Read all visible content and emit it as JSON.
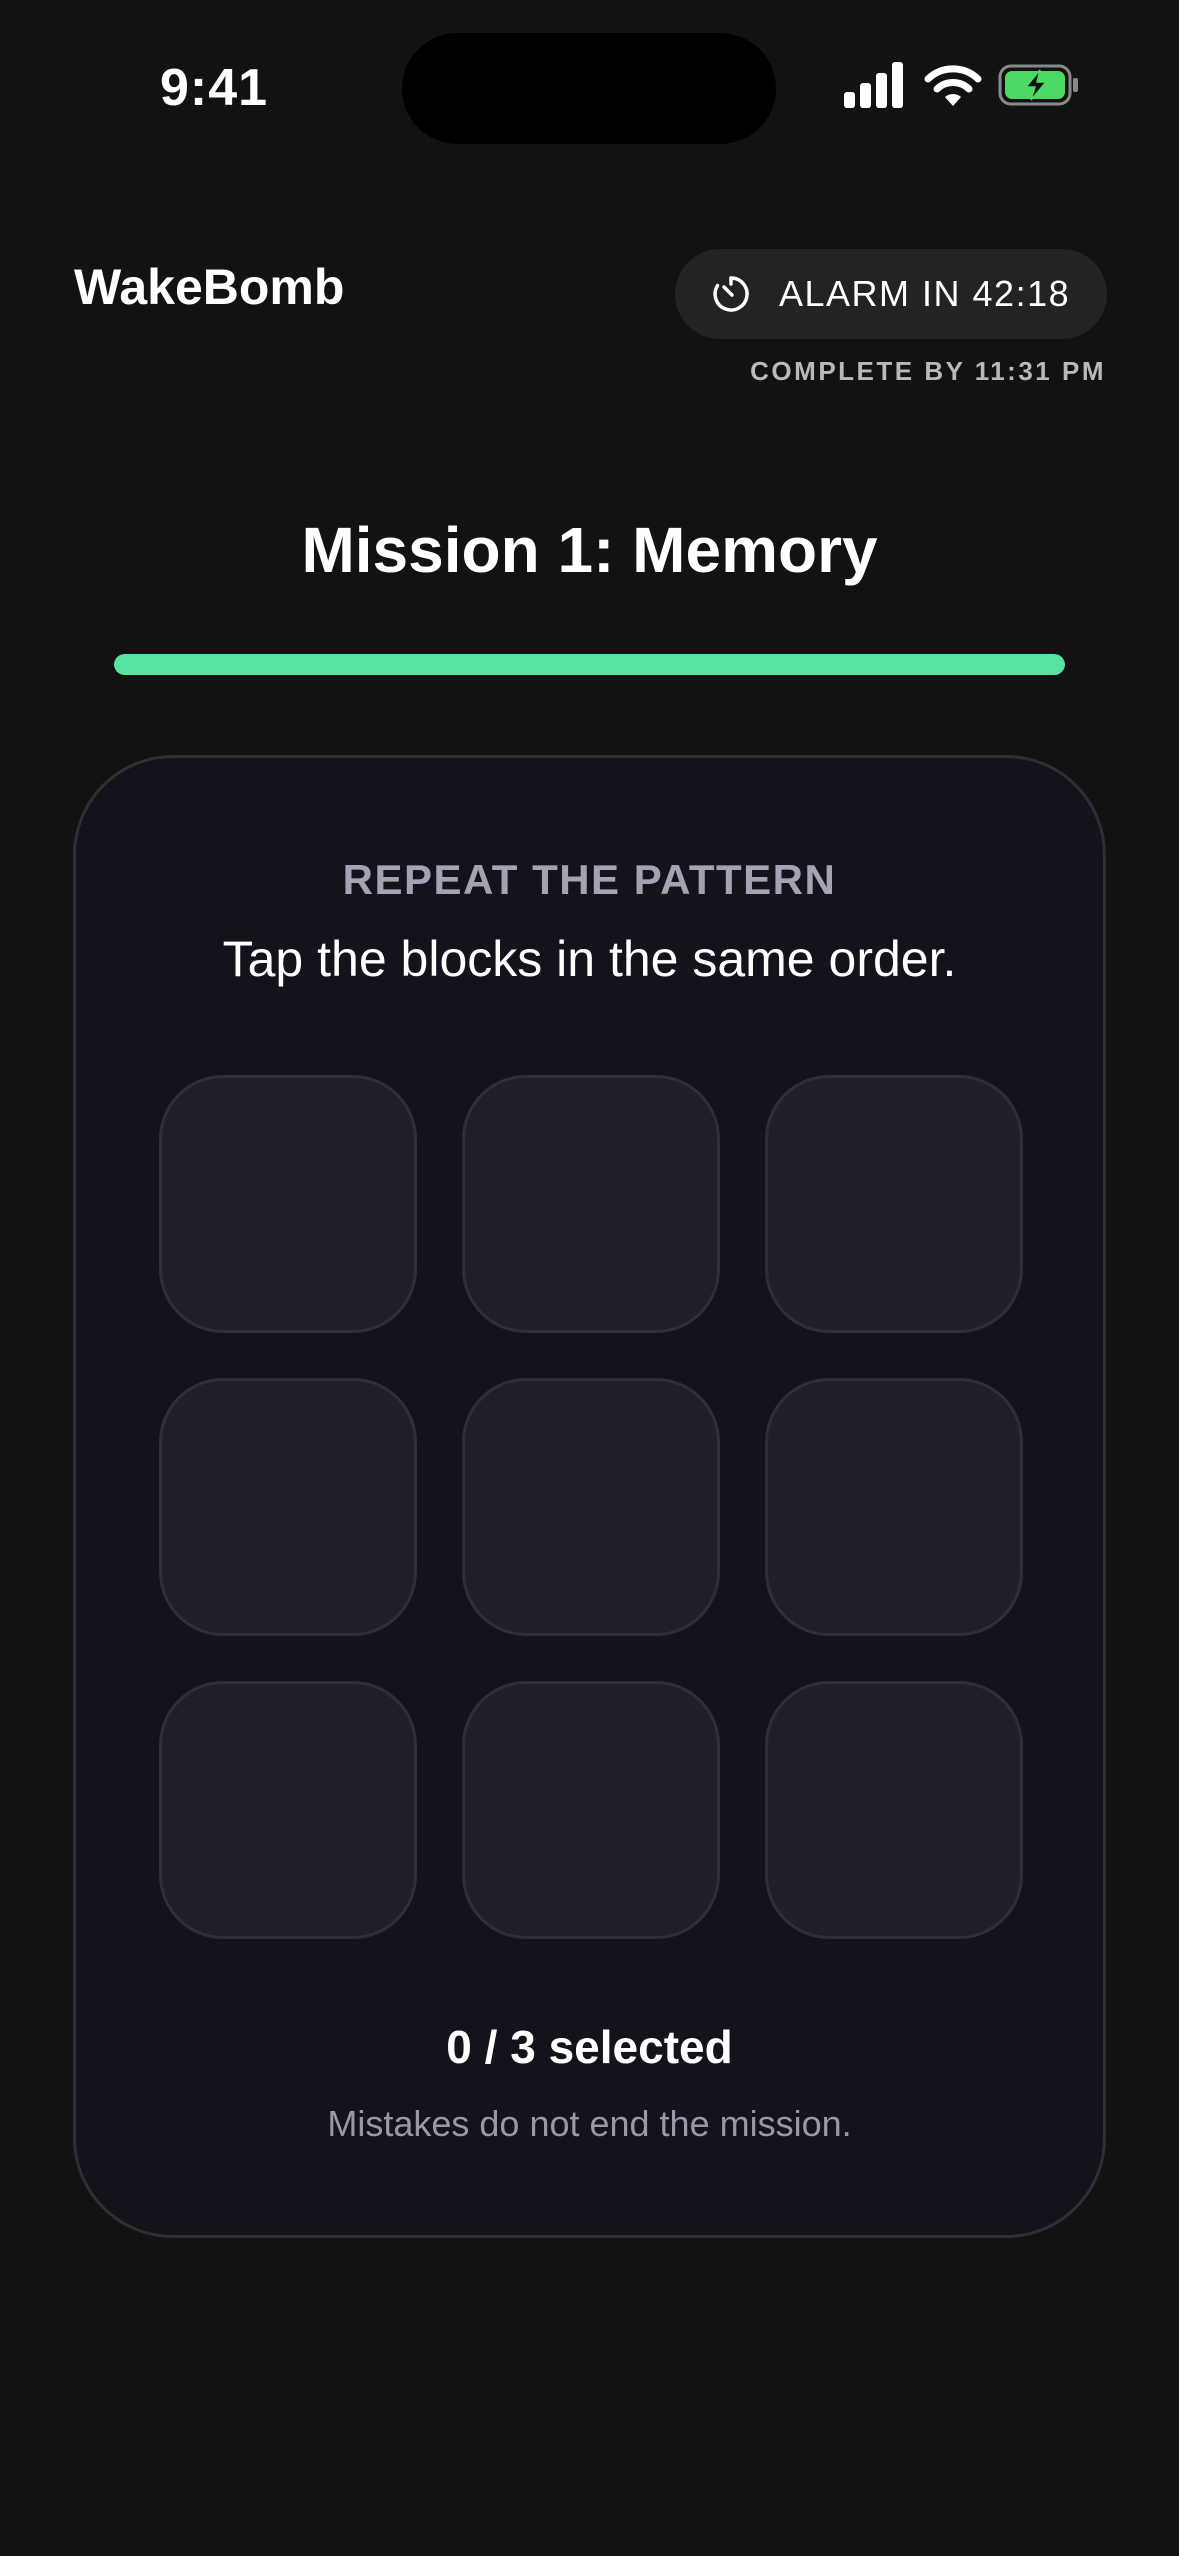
{
  "status_bar": {
    "time": "9:41",
    "icons": [
      "signal-icon",
      "wifi-icon",
      "battery-charging-icon"
    ]
  },
  "header": {
    "app_title": "WakeBomb",
    "alarm_label": "ALARM IN 42:18",
    "alarm_icon": "timer-icon",
    "complete_by": "COMPLETE BY 11:31 PM"
  },
  "mission": {
    "title": "Mission 1: Memory",
    "progress_percent": 100
  },
  "card": {
    "kicker": "REPEAT THE PATTERN",
    "instruction": "Tap the blocks in the same order.",
    "grid": {
      "rows": 3,
      "columns": 3,
      "tiles_selected": 0
    },
    "selected_count": "0 / 3 selected",
    "note": "Mistakes do not end the mission."
  },
  "colors": {
    "background": "#121212",
    "card": "#14131b",
    "tile": "#201f28",
    "accent_progress": "#56e3a2",
    "battery_green": "#4cd964"
  }
}
